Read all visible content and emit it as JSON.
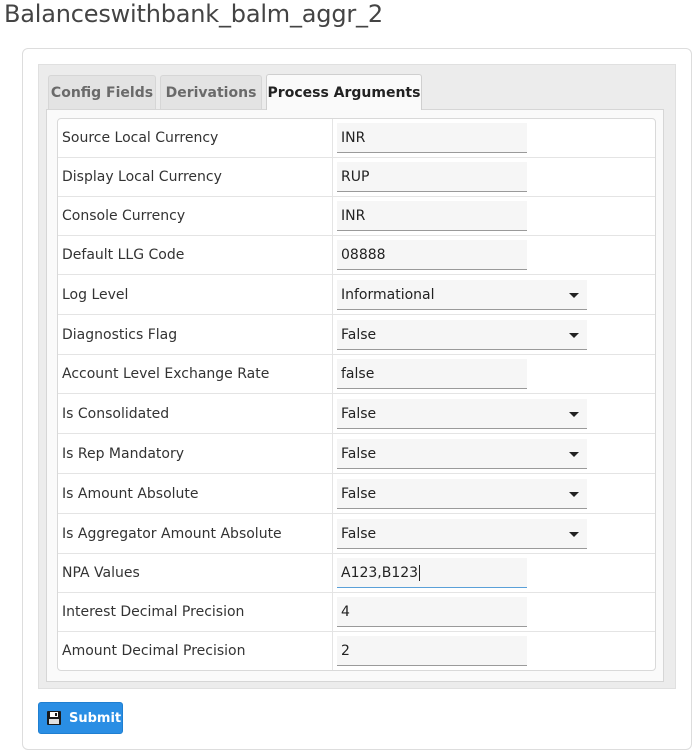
{
  "page": {
    "title": "Balanceswithbank_balm_aggr_2"
  },
  "tabs": [
    {
      "label": "Config Fields"
    },
    {
      "label": "Derivations"
    },
    {
      "label": "Process Arguments"
    }
  ],
  "fields": [
    {
      "label": "Source Local Currency",
      "value": "INR"
    },
    {
      "label": "Display Local Currency",
      "value": "RUP"
    },
    {
      "label": "Console Currency",
      "value": "INR"
    },
    {
      "label": "Default LLG Code",
      "value": "08888"
    },
    {
      "label": "Log Level",
      "value": "Informational"
    },
    {
      "label": "Diagnostics Flag",
      "value": "False"
    },
    {
      "label": "Account Level Exchange Rate",
      "value": "false"
    },
    {
      "label": "Is Consolidated",
      "value": "False"
    },
    {
      "label": "Is Rep Mandatory",
      "value": "False"
    },
    {
      "label": "Is Amount Absolute",
      "value": "False"
    },
    {
      "label": "Is Aggregator Amount Absolute",
      "value": "False"
    },
    {
      "label": "NPA Values",
      "value": "A123,B123"
    },
    {
      "label": "Interest Decimal Precision",
      "value": "4"
    },
    {
      "label": "Amount Decimal Precision",
      "value": "2"
    }
  ],
  "submit": {
    "label": "Submit"
  },
  "colors": {
    "accent": "#2a8ee4",
    "focus_underline": "#5aa0d8"
  },
  "icons": {
    "submit": "floppy-disk-icon",
    "dropdown": "caret-down-icon"
  }
}
